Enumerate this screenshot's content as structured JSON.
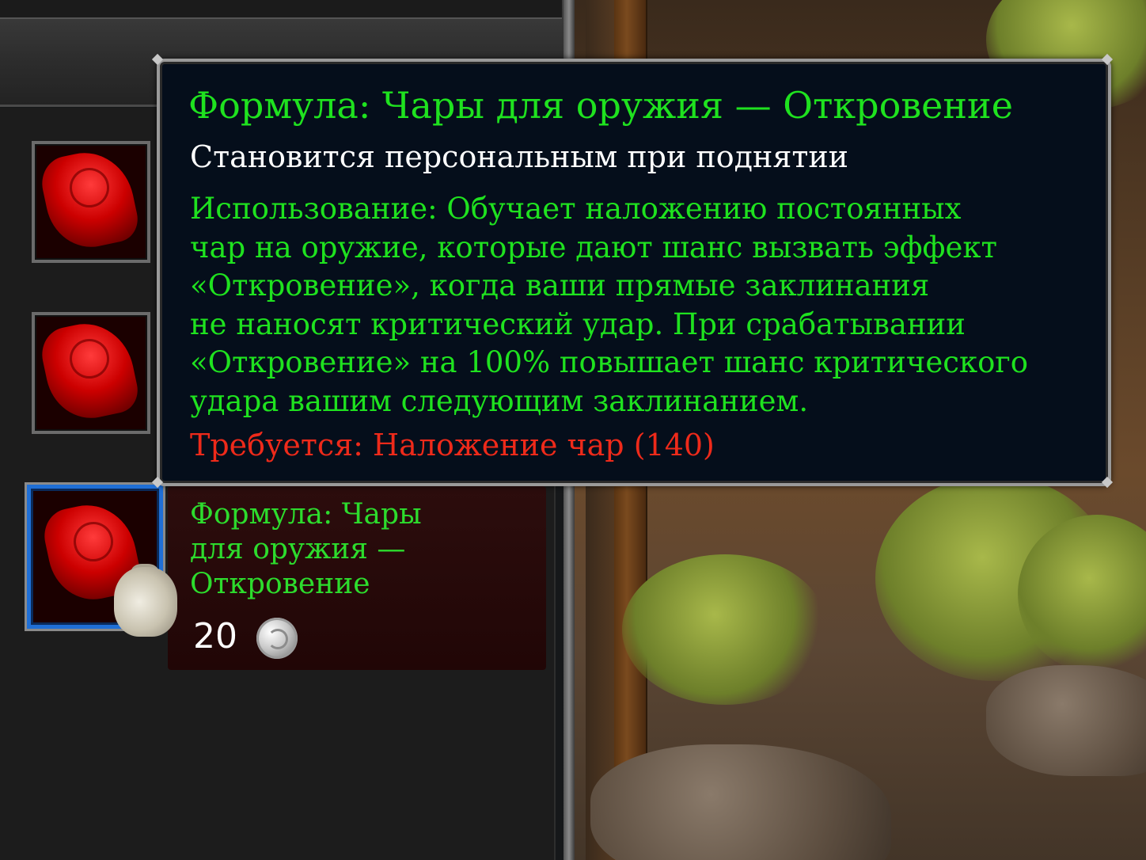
{
  "tooltip": {
    "title": "Формула: Чары для оружия — Откровение",
    "bind": "Становится персональным при поднятии",
    "use_lines": [
      "Использование: Обучает наложению постоянных",
      "чар на оружие, которые дают шанс вызвать эффект",
      "«Откровение», когда ваши прямые заклинания",
      "не наносят критический удар. При срабатывании",
      "«Откровение» на 100% повышает шанс критического",
      "удара вашим следующим заклинанием."
    ],
    "requires": "Требуется: Наложение чар (140)",
    "colors": {
      "title": "#1fe21f",
      "use": "#1fe21f",
      "bind": "#ffffff",
      "requires": "#ee2a1a",
      "background": "#050e1b"
    }
  },
  "merchant_items": [
    {
      "icon": "red-recipe-scroll-icon"
    },
    {
      "icon": "red-recipe-scroll-icon"
    },
    {
      "icon": "red-recipe-scroll-icon",
      "name_lines": [
        "Формула: Чары",
        "для оружия —",
        "Откровение"
      ],
      "price": "20",
      "currency_icon": "silver-coin-icon",
      "overlay_icon": "money-bag-icon",
      "selected": true
    }
  ]
}
